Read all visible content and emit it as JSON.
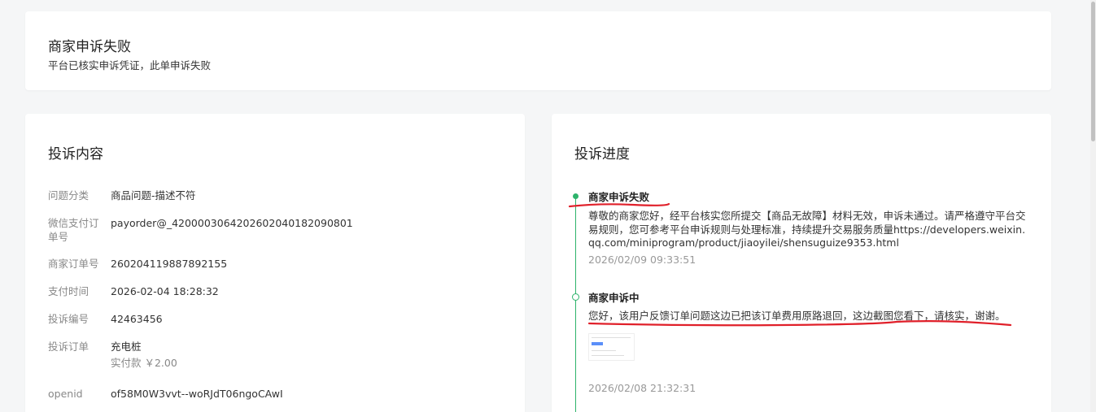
{
  "status": {
    "title": "商家申诉失败",
    "subtitle": "平台已核实申诉凭证，此单申诉失败"
  },
  "complaint": {
    "heading": "投诉内容",
    "fields": [
      {
        "label": "问题分类",
        "value": "商品问题-描述不符"
      },
      {
        "label": "微信支付订单号",
        "value": "payorder@_4200003064202602040182090801"
      },
      {
        "label": "商家订单号",
        "value": "260204119887892155"
      },
      {
        "label": "支付时间",
        "value": "2026-02-04 18:28:32"
      },
      {
        "label": "投诉编号",
        "value": "42463456"
      },
      {
        "label": "投诉订单",
        "value": "充电桩",
        "sub": "实付款 ￥2.00"
      },
      {
        "label": "openid",
        "value": "of58M0W3vvt--woRJdT06ngoCAwI"
      }
    ]
  },
  "progress": {
    "heading": "投诉进度",
    "events": [
      {
        "title": "商家申诉失败",
        "text": "尊敬的商家您好，经平台核实您所提交【商品无故障】材料无效，申诉未通过。请严格遵守平台交易规则，您可参考平台申诉规则与处理标准，持续提升交易服务质量https://developers.weixin.qq.com/miniprogram/product/jiaoyilei/shensuguize9353.html",
        "time": "2026/02/09 09:33:51"
      },
      {
        "title": "商家申诉中",
        "text": "您好，该用户反馈订单问题这边已把该订单费用原路退回，这边截图您看下，请核实，谢谢。",
        "time": "2026/02/08 21:32:31"
      }
    ]
  },
  "colors": {
    "timeline": "#2db36b",
    "annotation": "#e0202a"
  }
}
